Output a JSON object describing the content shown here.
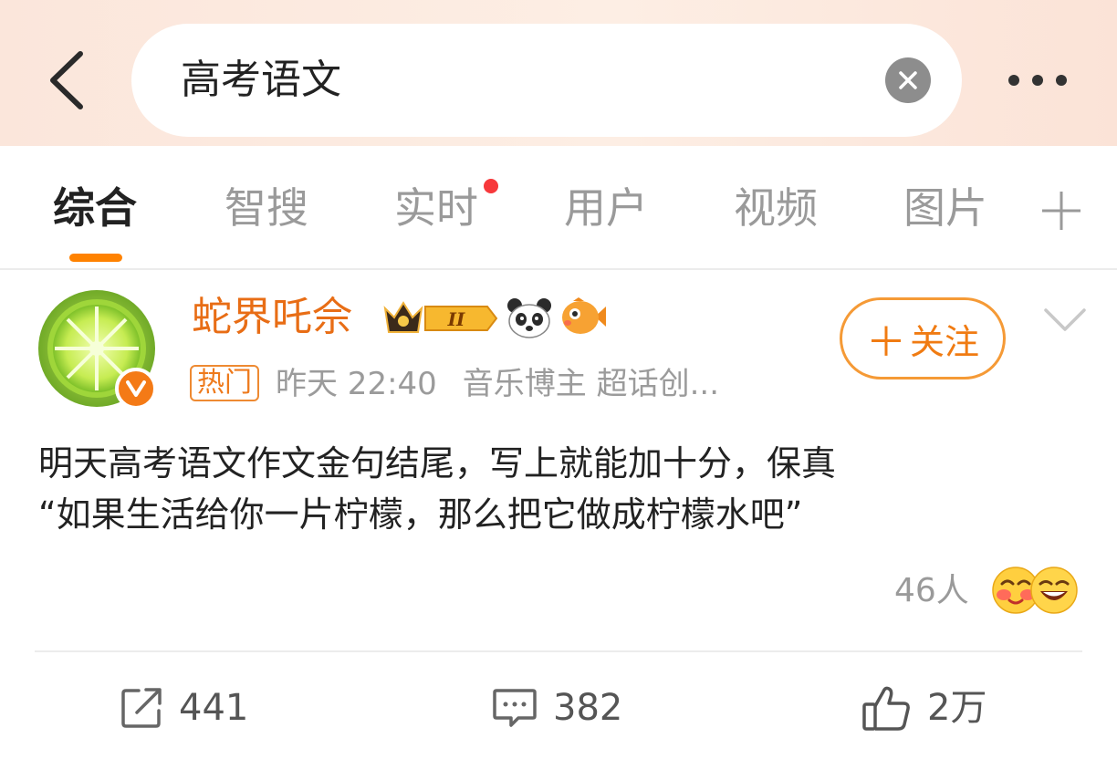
{
  "header": {
    "back_icon": "chevron-left-icon",
    "search_query": "高考语文",
    "clear_icon": "close-circle-icon",
    "more_icon": "more-horizontal-icon",
    "background_color": "#fcebe1"
  },
  "tabs": {
    "items": [
      {
        "label": "综合",
        "active": true
      },
      {
        "label": "智搜",
        "active": false
      },
      {
        "label": "实时",
        "active": false,
        "has_red_dot": true
      },
      {
        "label": "用户",
        "active": false
      },
      {
        "label": "视频",
        "active": false
      },
      {
        "label": "图片",
        "active": false
      }
    ],
    "add_icon": "plus-icon",
    "accent_color": "#ff8200"
  },
  "post": {
    "username": "蛇界吒佘",
    "avatar_icon": "lime-slice-avatar",
    "verified_icon": "verified-v-icon",
    "badges": [
      "crown-level-badge",
      "panda-icon",
      "fish-icon"
    ],
    "level_badge_text": "II",
    "follow_label": "关注",
    "follow_plus": "＋",
    "menu_icon": "chevron-down-icon",
    "hot_tag": "热门",
    "time": "昨天 22:40",
    "description": "音乐博主 超话创...",
    "text_line1": "明天高考语文作文金句结尾，写上就能加十分，保真",
    "text_line2": "“如果生活给你一片柠檬，那么把它做成柠檬水吧”",
    "reaction_count": "46人",
    "reaction_icons": [
      "blush-emoji-icon",
      "grin-emoji-icon"
    ],
    "username_color": "#e86d15"
  },
  "actions": {
    "share_icon": "share-icon",
    "share_count": "441",
    "comment_icon": "comment-icon",
    "comment_count": "382",
    "like_icon": "thumbs-up-icon",
    "like_count": "2万"
  }
}
